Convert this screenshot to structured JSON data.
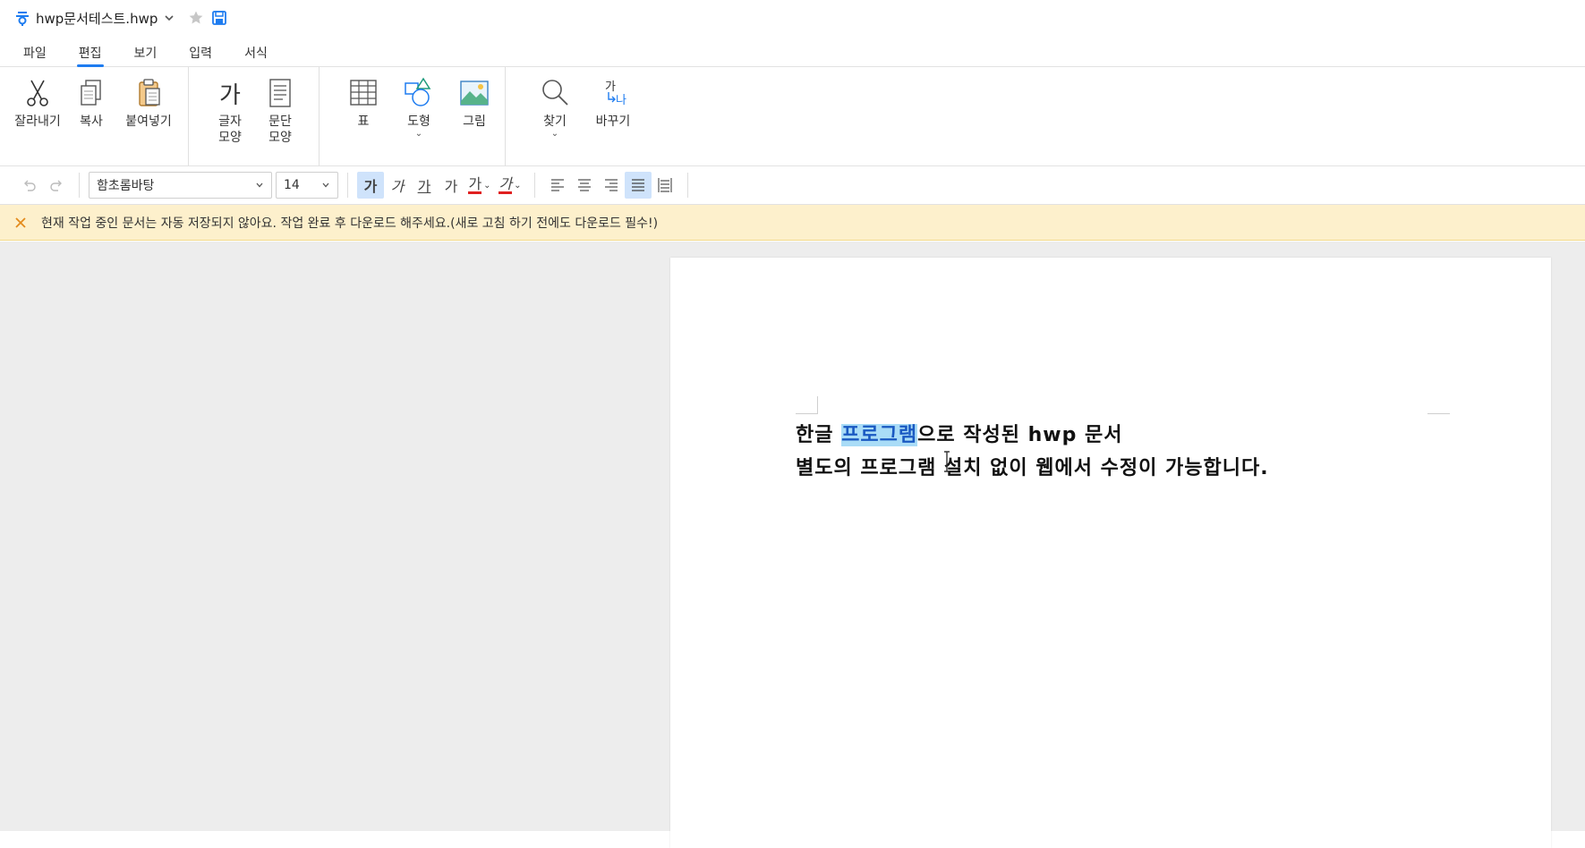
{
  "title": {
    "doc_name": "hwp문서테스트.hwp"
  },
  "menu": {
    "tabs": [
      "파일",
      "편집",
      "보기",
      "입력",
      "서식"
    ],
    "active": "편집"
  },
  "ribbon": {
    "cut": "잘라내기",
    "copy": "복사",
    "paste": "붙여넣기",
    "char_shape_1": "글자",
    "char_shape_2": "모양",
    "para_shape_1": "문단",
    "para_shape_2": "모양",
    "table": "표",
    "shape": "도형",
    "image": "그림",
    "find": "찾기",
    "replace": "바꾸기",
    "char_icon_text": "가",
    "replace_icon_top": "가",
    "replace_icon_bottom": "나"
  },
  "format": {
    "font_name": "함초롬바탕",
    "font_size": "14",
    "bold": "가",
    "italic": "가",
    "underline": "가",
    "strike": "가",
    "font_color": "가",
    "highlight": "가"
  },
  "notice": {
    "text": "현재 작업 중인 문서는 자동 저장되지 않아요. 작업 완료 후 다운로드 해주세요.(새로 고침 하기 전에도 다운로드 필수!)"
  },
  "document": {
    "line1_before": "한글 ",
    "line1_selected": "프로그램",
    "line1_after": "으로 작성된 hwp 문서",
    "line2": "별도의 프로그램 설치 없이 웹에서 수정이 가능합니다."
  },
  "colors": {
    "accent": "#1e7cf0",
    "notice_bg": "#fdf0cc",
    "selection": "#a9dcf7"
  }
}
